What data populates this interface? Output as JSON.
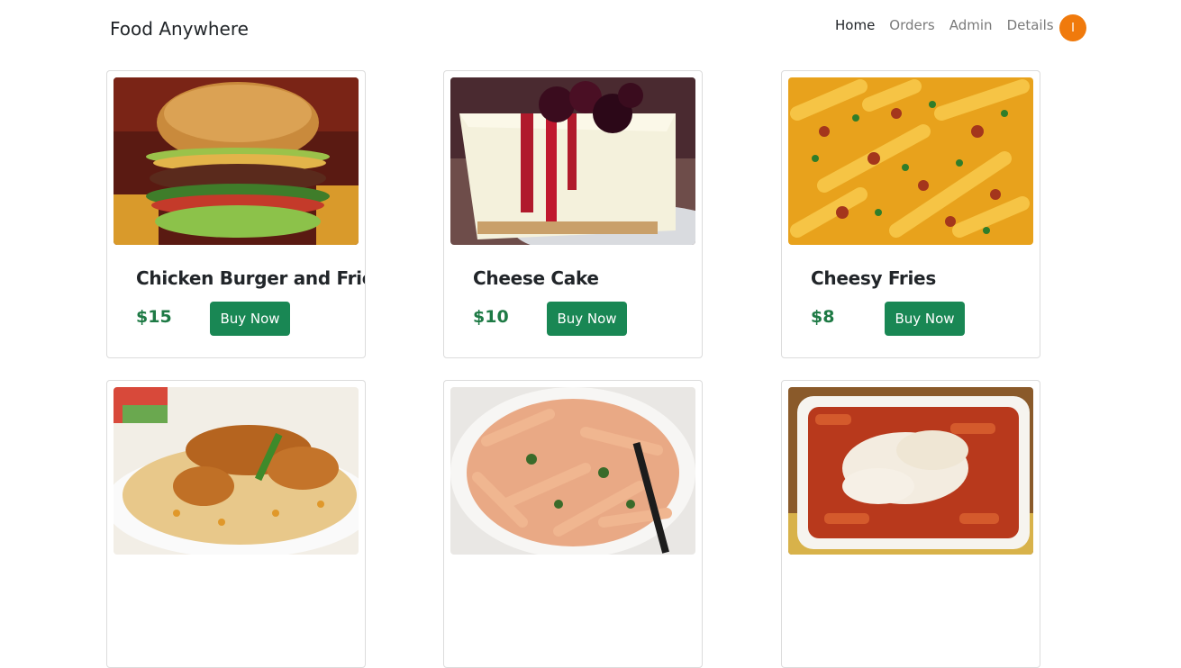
{
  "brand": {
    "name": "Food Anywhere"
  },
  "nav": {
    "links": [
      "Home",
      "Orders",
      "Admin",
      "Details"
    ],
    "active": "Home",
    "avatar_initial": "I"
  },
  "colors": {
    "accent_green": "#198754",
    "price_green": "#1e7a45",
    "avatar_orange": "#f07a0c"
  },
  "products": [
    {
      "name": "Chicken Burger and Fries",
      "price": "$15",
      "button": "Buy Now",
      "image": "burger-photo"
    },
    {
      "name": "Cheese Cake",
      "price": "$10",
      "button": "Buy Now",
      "image": "cheesecake-photo"
    },
    {
      "name": "Cheesy Fries",
      "price": "$8",
      "button": "Buy Now",
      "image": "cheesy-fries-photo"
    },
    {
      "name": "",
      "price": "",
      "button": "",
      "image": "biryani-photo"
    },
    {
      "name": "",
      "price": "",
      "button": "",
      "image": "penne-pasta-photo"
    },
    {
      "name": "",
      "price": "",
      "button": "",
      "image": "baked-pasta-photo"
    }
  ]
}
